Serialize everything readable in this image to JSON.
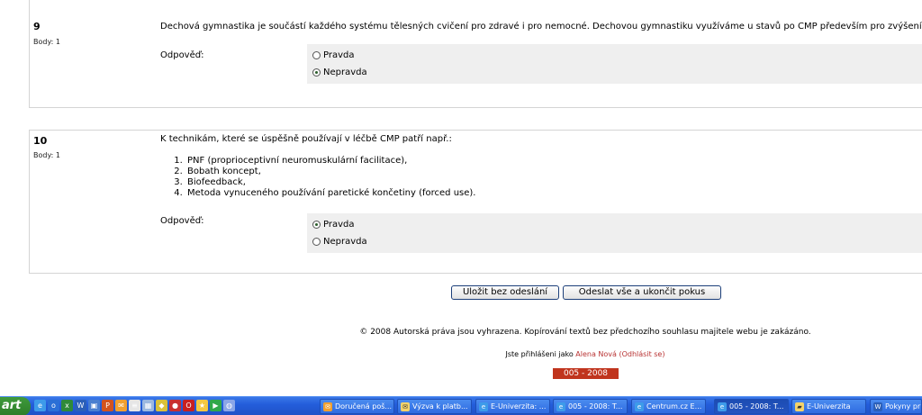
{
  "questions": [
    {
      "number": "9",
      "points": "Body: 1",
      "text": "Dechová gymnastika je součástí každého systému tělesných cvičení pro zdravé i pro nemocné. Dechovou gymnastiku využíváme u stavů po CMP především pro zvýšení plicní ventilace.",
      "answer_label": "Odpověď:",
      "options": [
        {
          "label": "Pravda",
          "checked": false
        },
        {
          "label": "Nepravda",
          "checked": true
        }
      ]
    },
    {
      "number": "10",
      "points": "Body: 1",
      "text": "K technikám, které se úspěšně používají v léčbě CMP patří např.:",
      "list": [
        "PNF (proprioceptivní neuromuskulární facilitace),",
        "Bobath koncept,",
        "Biofeedback,",
        "Metoda vynuceného používání paretické končetiny (forced use)."
      ],
      "answer_label": "Odpověď:",
      "options": [
        {
          "label": "Pravda",
          "checked": true
        },
        {
          "label": "Nepravda",
          "checked": false
        }
      ]
    }
  ],
  "buttons": {
    "save": "Uložit bez odeslání",
    "submit": "Odeslat vše a ukončit pokus"
  },
  "footer": {
    "copyright": "© 2008 Autorská práva jsou vyhrazena. Kopírování textů bez předchozího souhlasu majitele webu je zakázáno.",
    "login_prefix": "Jste přihlášeni jako",
    "user_name": "Alena Nová",
    "logout_open": "(",
    "logout": "Odhlásit se",
    "logout_close": ")",
    "course_code": "005 - 2008"
  },
  "taskbar": {
    "start_label": "art",
    "tasks": [
      {
        "label": "Doručená poš...",
        "icon": "mail-icon",
        "icon_color": "#f0a030"
      },
      {
        "label": "Výzva k platb...",
        "icon": "envelope-icon",
        "icon_color": "#f4d36a"
      },
      {
        "label": "E-Univerzita: ...",
        "icon": "ie-icon",
        "icon_color": "#3d9be9"
      },
      {
        "label": "005 - 2008: T...",
        "icon": "ie-icon",
        "icon_color": "#3d9be9"
      },
      {
        "label": "Centrum.cz E...",
        "icon": "ie-icon",
        "icon_color": "#3d9be9"
      },
      {
        "label": "005 - 2008: T...",
        "icon": "ie-icon",
        "icon_color": "#3d9be9",
        "active": true
      },
      {
        "label": "E-Univerzita",
        "icon": "folder-icon",
        "icon_color": "#f4d36a"
      },
      {
        "label": "Pokyny pr",
        "icon": "word-icon",
        "icon_color": "#2b5fb8"
      }
    ],
    "quicklaunch": [
      {
        "icon": "ie-icon",
        "color": "#3d9be9",
        "glyph": "e"
      },
      {
        "icon": "outlook-icon",
        "color": "#2a6fd6",
        "glyph": "o"
      },
      {
        "icon": "excel-icon",
        "color": "#2f8a3a",
        "glyph": "x"
      },
      {
        "icon": "word-icon",
        "color": "#2b5fb8",
        "glyph": "W"
      },
      {
        "icon": "window-icon",
        "color": "#4a7fd0",
        "glyph": "▣"
      },
      {
        "icon": "powerpoint-icon",
        "color": "#d2531f",
        "glyph": "P"
      },
      {
        "icon": "mail-icon",
        "color": "#f0a030",
        "glyph": "✉"
      },
      {
        "icon": "notes-icon",
        "color": "#e6e6e6",
        "glyph": "≡"
      },
      {
        "icon": "calculator-icon",
        "color": "#9bb8e0",
        "glyph": "▦"
      },
      {
        "icon": "shield-icon",
        "color": "#d9c13a",
        "glyph": "◆"
      },
      {
        "icon": "record-icon",
        "color": "#c83030",
        "glyph": "●"
      },
      {
        "icon": "opera-icon",
        "color": "#c82020",
        "glyph": "O"
      },
      {
        "icon": "star-icon",
        "color": "#f4c842",
        "glyph": "★"
      },
      {
        "icon": "play-icon",
        "color": "#2fa84a",
        "glyph": "▶"
      },
      {
        "icon": "globe-icon",
        "color": "#8aa6e8",
        "glyph": "◍"
      }
    ]
  }
}
